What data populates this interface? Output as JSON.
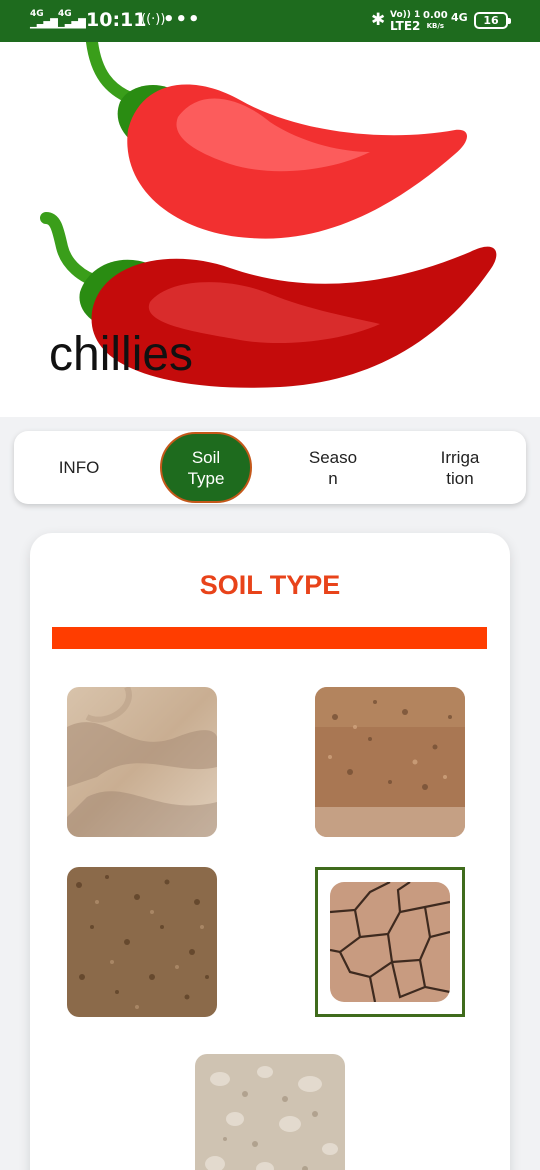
{
  "status_bar": {
    "signal1": "4G",
    "signal2": "4G",
    "time": "10:11",
    "dots": "•••",
    "volte": "Vo)) 1",
    "lte": "LTE2",
    "speed_value": "0.00",
    "speed_unit": "KB/s",
    "network": "4G",
    "battery": "16"
  },
  "hero": {
    "crop_name": "chillies"
  },
  "tabs": [
    {
      "line1": "INFO",
      "line2": ""
    },
    {
      "line1": "Soil",
      "line2": "Type"
    },
    {
      "line1": "Seaso",
      "line2": "n"
    },
    {
      "line1": "Irriga",
      "line2": "tion"
    }
  ],
  "active_tab": "Soil Type",
  "soil_section": {
    "title": "SOIL TYPE",
    "accent_color": "#ff3d00",
    "title_color": "#e8431a",
    "soil_images": [
      "sandy-soil",
      "red-soil",
      "loamy-soil",
      "cracked-clay-soil",
      "gravel-soil"
    ],
    "selected_image": "cracked-clay-soil"
  },
  "colors": {
    "status_bar": "#1e6b1e",
    "active_tab_bg": "#1e6b1e",
    "active_tab_border": "#c4581a"
  }
}
